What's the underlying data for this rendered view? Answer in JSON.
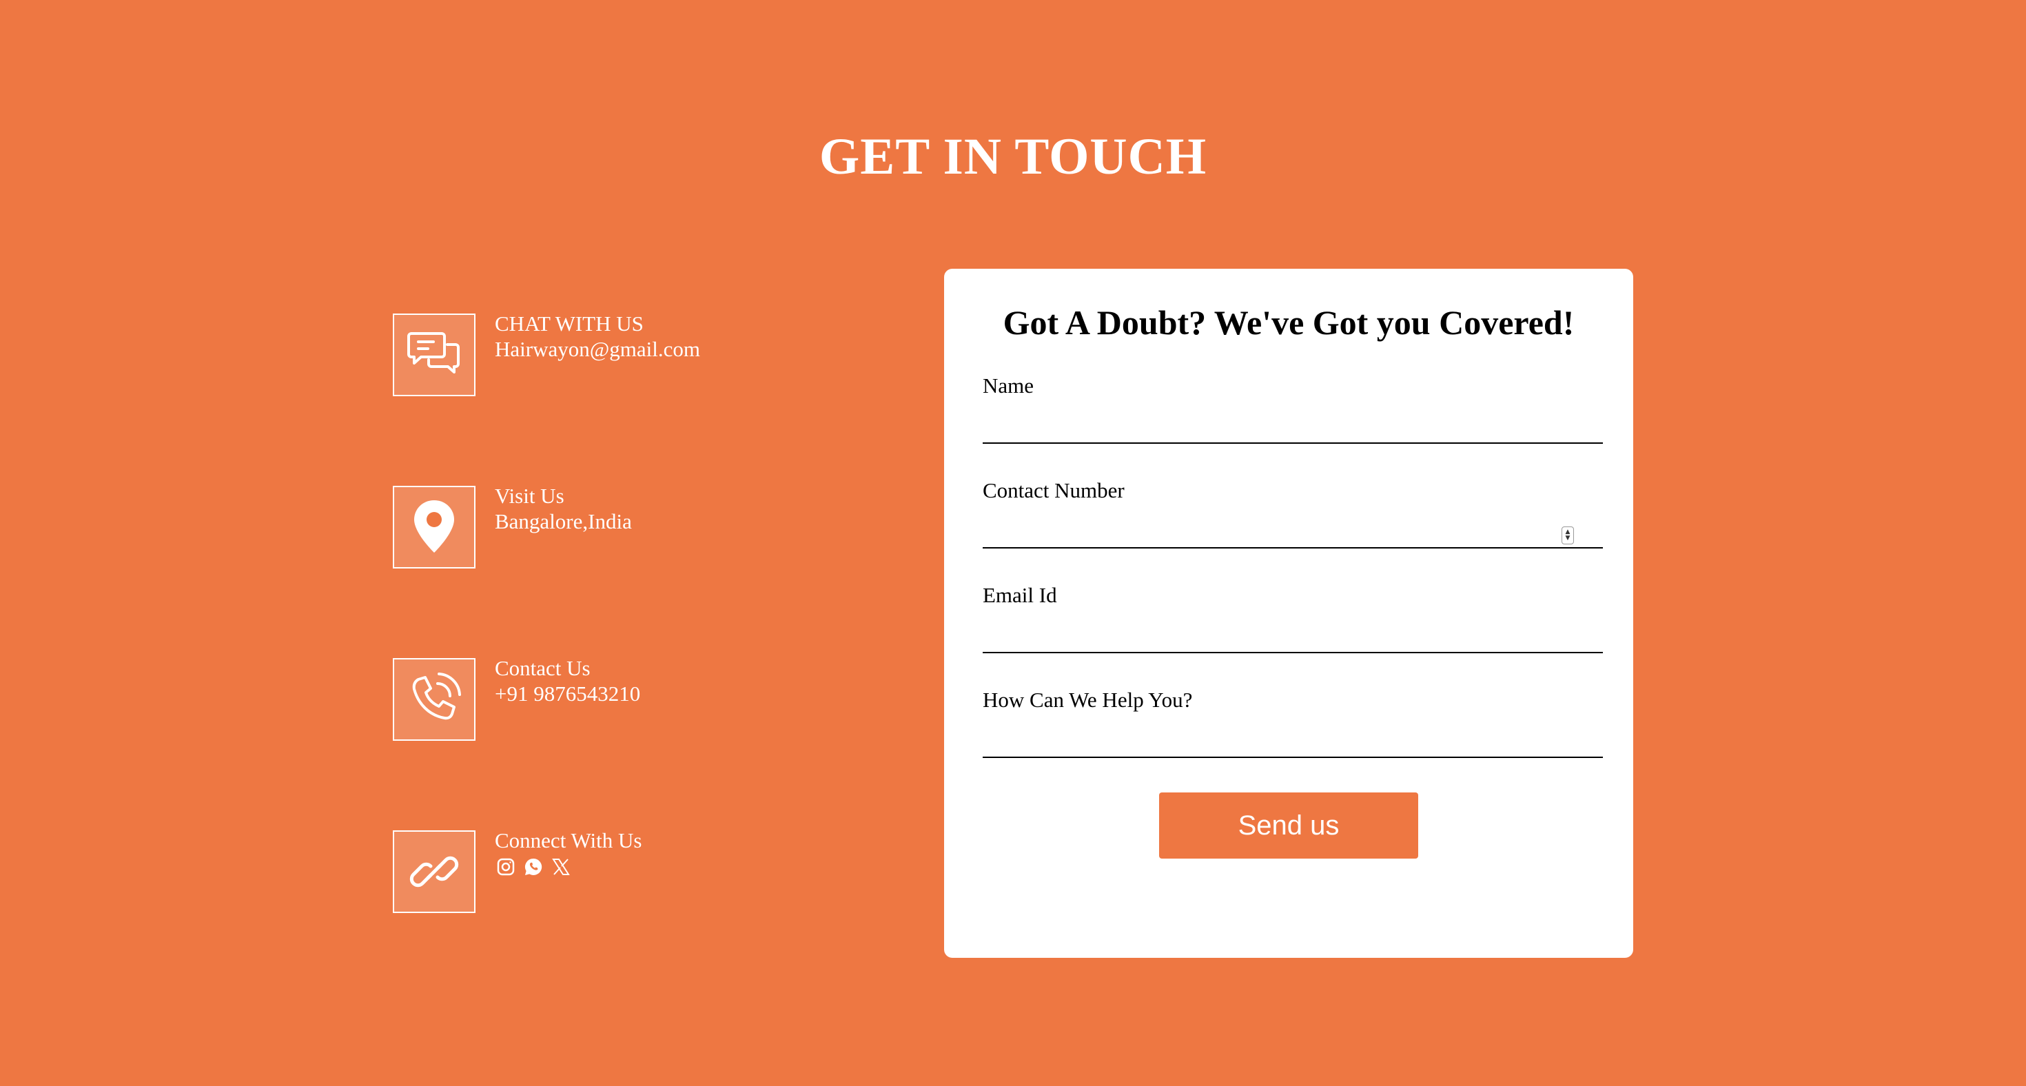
{
  "page": {
    "title": "GET IN TOUCH",
    "background_color": "#ee7742"
  },
  "contact_info": [
    {
      "heading": "CHAT WITH US",
      "detail": "Hairwayon@gmail.com",
      "icon": "chat-icon"
    },
    {
      "heading": "Visit Us",
      "detail": "Bangalore,India",
      "icon": "location-pin-icon"
    },
    {
      "heading": "Contact Us",
      "detail": "+91 9876543210",
      "icon": "phone-icon"
    },
    {
      "heading": "Connect With Us",
      "detail": "",
      "icon": "link-icon"
    }
  ],
  "social_icons": [
    "instagram-icon",
    "whatsapp-icon",
    "x-twitter-icon"
  ],
  "form": {
    "title": "Got A Doubt? We've Got you Covered!",
    "fields": [
      {
        "label": "Name",
        "value": "",
        "type": "text"
      },
      {
        "label": "Contact Number",
        "value": "",
        "type": "number"
      },
      {
        "label": "Email Id",
        "value": "",
        "type": "email"
      },
      {
        "label": "How Can We Help You?",
        "value": "",
        "type": "text"
      }
    ],
    "submit_label": "Send us",
    "button_color": "#ee7742"
  }
}
